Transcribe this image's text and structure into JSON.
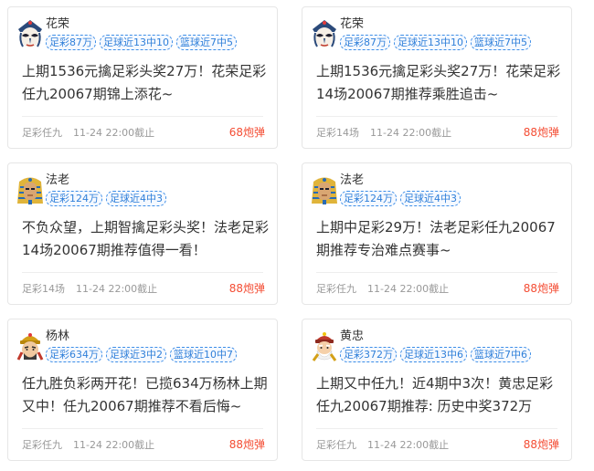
{
  "cards": [
    {
      "author": "花荣",
      "avatar_icon": "peking-opera-mask-avatar",
      "tags": [
        "足彩87万",
        "足球近13中10",
        "篮球近7中5"
      ],
      "title": "上期1536元擒足彩头奖27万！花荣足彩任九20067期锦上添花~",
      "category": "足彩任九",
      "time": "11-24 22:00截止",
      "price": "68炮弹"
    },
    {
      "author": "花荣",
      "avatar_icon": "peking-opera-mask-avatar",
      "tags": [
        "足彩87万",
        "足球近13中10",
        "篮球近7中5"
      ],
      "title": "上期1536元擒足彩头奖27万！花荣足彩14场20067期推荐乘胜追击~",
      "category": "足彩14场",
      "time": "11-24 22:00截止",
      "price": "88炮弹"
    },
    {
      "author": "法老",
      "avatar_icon": "pharaoh-avatar",
      "tags": [
        "足彩124万",
        "足球近4中3"
      ],
      "title": "不负众望，上期智擒足彩头奖！法老足彩14场20067期推荐值得一看！",
      "category": "足彩14场",
      "time": "11-24 22:00截止",
      "price": "88炮弹"
    },
    {
      "author": "法老",
      "avatar_icon": "pharaoh-avatar",
      "tags": [
        "足彩124万",
        "足球近4中3"
      ],
      "title": "上期中足彩29万！法老足彩任九20067期推荐专治难点赛事~",
      "category": "足彩任九",
      "time": "11-24 22:00截止",
      "price": "88炮弹"
    },
    {
      "author": "杨林",
      "avatar_icon": "ancient-general-avatar",
      "tags": [
        "足彩634万",
        "足球近3中2",
        "篮球近10中7"
      ],
      "title": "任九胜负彩两开花！已揽634万杨林上期又中！任九20067期推荐不看后悔~",
      "category": "足彩任九",
      "time": "11-24 22:00截止",
      "price": "88炮弹"
    },
    {
      "author": "黄忠",
      "avatar_icon": "old-general-avatar",
      "tags": [
        "足彩372万",
        "足球近13中6",
        "篮球近7中6"
      ],
      "title": "上期又中任九！近4期中3次！黄忠足彩任九20067期推荐: 历史中奖372万",
      "category": "足彩任九",
      "time": "11-24 22:00截止",
      "price": "88炮弹"
    }
  ]
}
